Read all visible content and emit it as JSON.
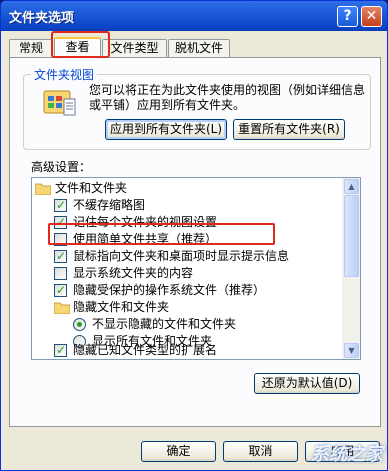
{
  "window": {
    "title": "文件夹选项"
  },
  "title_buttons": {
    "help": "?",
    "close": "✕"
  },
  "tabs": [
    {
      "label": "常规"
    },
    {
      "label": "查看"
    },
    {
      "label": "文件类型"
    },
    {
      "label": "脱机文件"
    }
  ],
  "folder_views": {
    "group_label": "文件夹视图",
    "description": "您可以将正在为此文件夹使用的视图（例如详细信息或平铺）应用到所有文件夹。",
    "apply_all_button": "应用到所有文件夹(L)",
    "reset_all_button": "重置所有文件夹(R)"
  },
  "advanced": {
    "label": "高级设置：",
    "items": [
      {
        "type": "folder",
        "text": "文件和文件夹"
      },
      {
        "type": "checkbox",
        "checked": true,
        "text": "不缓存缩略图"
      },
      {
        "type": "checkbox",
        "checked": true,
        "text": "记住每个文件夹的视图设置"
      },
      {
        "type": "checkbox",
        "checked": false,
        "text": "使用简单文件共享（推荐）"
      },
      {
        "type": "checkbox",
        "checked": true,
        "text": "鼠标指向文件夹和桌面项时显示提示信息"
      },
      {
        "type": "checkbox",
        "checked": false,
        "text": "显示系统文件夹的内容"
      },
      {
        "type": "checkbox",
        "checked": true,
        "text": "隐藏受保护的操作系统文件（推荐）"
      },
      {
        "type": "folder",
        "text": "隐藏文件和文件夹"
      },
      {
        "type": "radio",
        "checked": true,
        "text": "不显示隐藏的文件和文件夹"
      },
      {
        "type": "radio",
        "checked": false,
        "text": "显示所有文件和文件夹"
      },
      {
        "type": "checkbox",
        "checked": true,
        "text": "隐藏已知文件类型的扩展名"
      }
    ],
    "restore_defaults_button": "还原为默认值(D)"
  },
  "footer": {
    "ok_button": "确定",
    "cancel_button": "取消",
    "apply_button": "应用"
  },
  "watermark": "系统之家",
  "colors": {
    "title_bar": "#1c5ad8",
    "highlight": "#e0281c",
    "group_label": "#0046d5"
  }
}
